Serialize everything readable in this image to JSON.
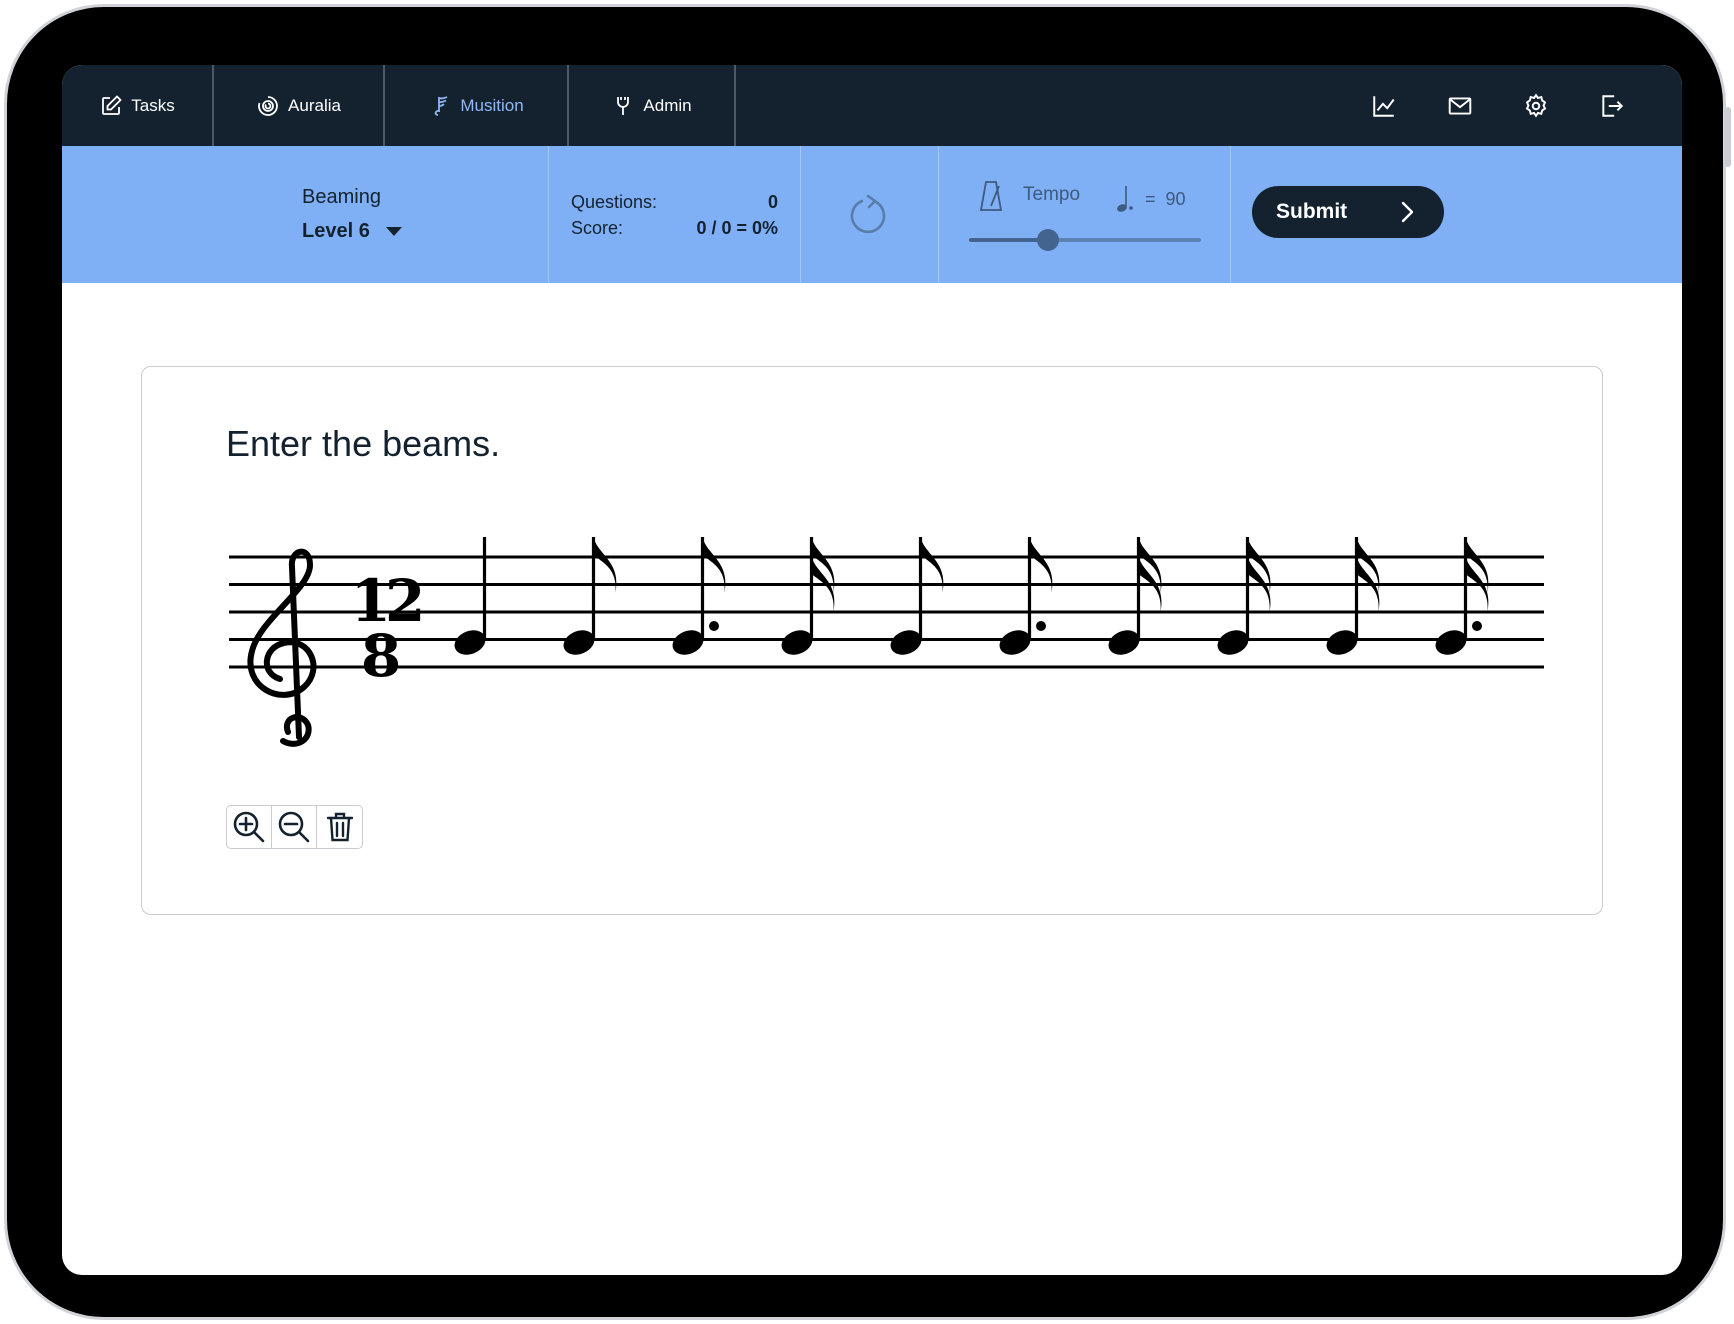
{
  "nav": {
    "tabs": [
      {
        "label": "Tasks",
        "icon": "edit-icon"
      },
      {
        "label": "Auralia",
        "icon": "auralia-logo-icon"
      },
      {
        "label": "Musition",
        "icon": "musition-logo-icon"
      },
      {
        "label": "Admin",
        "icon": "admin-icon"
      }
    ],
    "active_tab": "Musition",
    "right_icons": [
      "stats-chart-icon",
      "mail-icon",
      "gear-icon",
      "logout-icon"
    ]
  },
  "toolbar": {
    "topic": "Beaming",
    "level": "Level 6",
    "questions_label": "Questions:",
    "questions_value": "0",
    "score_label": "Score:",
    "score_value": "0 / 0 = 0%",
    "tempo_label": "Tempo",
    "tempo_equals": "=",
    "tempo_value": "90",
    "tempo_slider_fraction": 0.34,
    "submit_label": "Submit"
  },
  "exercise": {
    "prompt": "Enter the beams.",
    "clef": "treble",
    "time_signature": {
      "top": "12",
      "bottom": "8"
    },
    "notes": [
      "quarter",
      "eighth",
      "dotted-eighth",
      "sixteenth",
      "eighth",
      "dotted-eighth",
      "sixteenth",
      "sixteenth",
      "sixteenth",
      "dotted-sixteenth"
    ],
    "tools": [
      "zoom-in-icon",
      "zoom-out-icon",
      "trash-icon"
    ]
  },
  "colors": {
    "nav_bg": "#14222f",
    "toolbar_bg": "#7fb0f6",
    "active_tab": "#8fb8f5",
    "text_dark": "#14222f"
  }
}
